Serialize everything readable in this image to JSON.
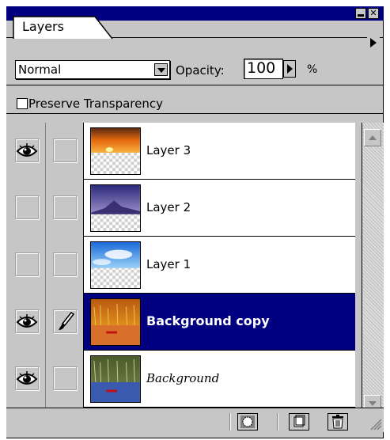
{
  "window": {
    "minimize_icon": "minimize-icon",
    "close_label": "✕"
  },
  "tabs": [
    {
      "label": "Layers"
    }
  ],
  "blend": {
    "mode": "Normal",
    "opacity_label": "Opacity:",
    "opacity_value": "100",
    "opacity_unit": "%"
  },
  "preserve_transparency": {
    "label": "Preserve Transparency",
    "checked": false
  },
  "layers": [
    {
      "name": "Layer 3",
      "visible": true,
      "editing": false,
      "selected": false,
      "italic": false
    },
    {
      "name": "Layer 2",
      "visible": false,
      "editing": false,
      "selected": false,
      "italic": false
    },
    {
      "name": "Layer 1",
      "visible": false,
      "editing": false,
      "selected": false,
      "italic": false
    },
    {
      "name": "Background copy",
      "visible": true,
      "editing": true,
      "selected": true,
      "italic": false
    },
    {
      "name": "Background",
      "visible": true,
      "editing": false,
      "selected": false,
      "italic": true
    }
  ],
  "colors": {
    "titlebar": "#000080",
    "selection": "#000080",
    "panel": "#c6c6c6"
  }
}
